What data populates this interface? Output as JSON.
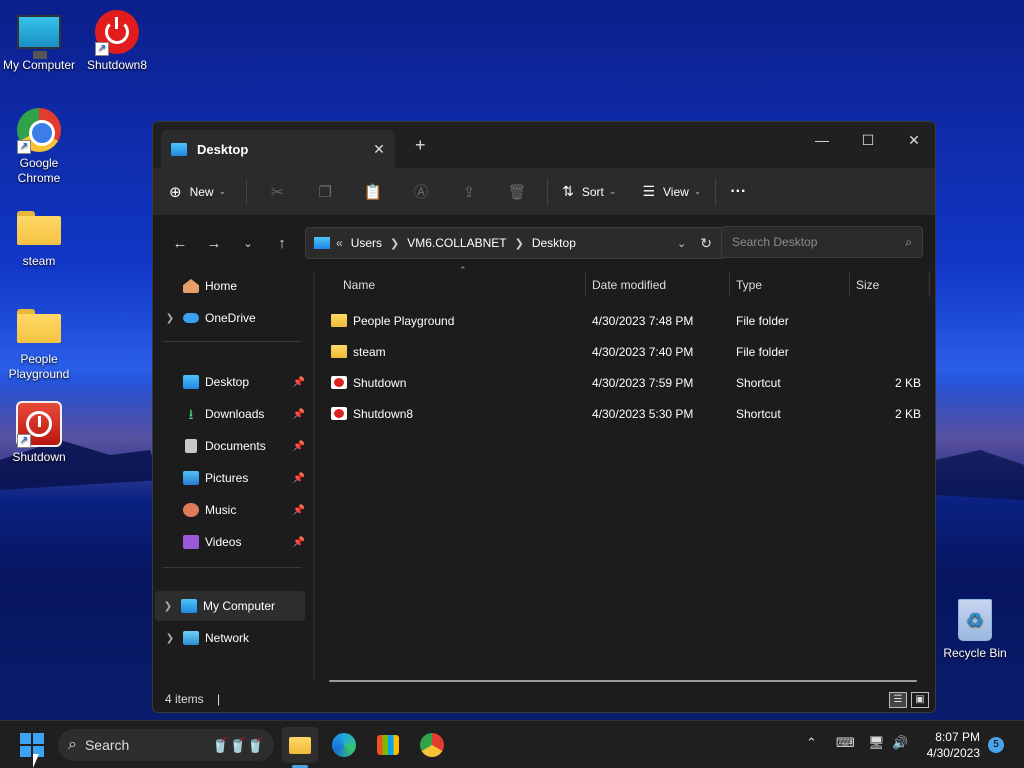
{
  "desktop": {
    "icons": [
      {
        "label": "My Computer",
        "icon": "computer-icon"
      },
      {
        "label": "Shutdown8",
        "icon": "power-icon"
      },
      {
        "label": "Google Chrome",
        "icon": "chrome-icon"
      },
      {
        "label": "steam",
        "icon": "folder-icon"
      },
      {
        "label": "People Playground",
        "icon": "folder-icon"
      },
      {
        "label": "Shutdown",
        "icon": "power-icon"
      },
      {
        "label": "Recycle Bin",
        "icon": "recycle-bin-icon"
      }
    ]
  },
  "explorer": {
    "tab_title": "Desktop",
    "toolbar": {
      "new_label": "New",
      "sort_label": "Sort",
      "view_label": "View",
      "more_label": "···"
    },
    "address": {
      "overflow": "«",
      "crumbs": [
        "Users",
        "VM6.COLLABNET",
        "Desktop"
      ]
    },
    "search": {
      "placeholder": "Search Desktop"
    },
    "nav": {
      "home": "Home",
      "onedrive": "OneDrive",
      "desktop": "Desktop",
      "downloads": "Downloads",
      "documents": "Documents",
      "pictures": "Pictures",
      "music": "Music",
      "videos": "Videos",
      "my_computer": "My Computer",
      "network": "Network"
    },
    "columns": {
      "name": "Name",
      "date": "Date modified",
      "type": "Type",
      "size": "Size"
    },
    "files": [
      {
        "name": "People Playground",
        "date": "4/30/2023 7:48 PM",
        "type": "File folder",
        "size": ""
      },
      {
        "name": "steam",
        "date": "4/30/2023 7:40 PM",
        "type": "File folder",
        "size": ""
      },
      {
        "name": "Shutdown",
        "date": "4/30/2023 7:59 PM",
        "type": "Shortcut",
        "size": "2 KB"
      },
      {
        "name": "Shutdown8",
        "date": "4/30/2023 5:30 PM",
        "type": "Shortcut",
        "size": "2 KB"
      }
    ],
    "status": "4 items"
  },
  "taskbar": {
    "search_label": "Search",
    "time": "8:07 PM",
    "date": "4/30/2023",
    "notifications": "5"
  }
}
